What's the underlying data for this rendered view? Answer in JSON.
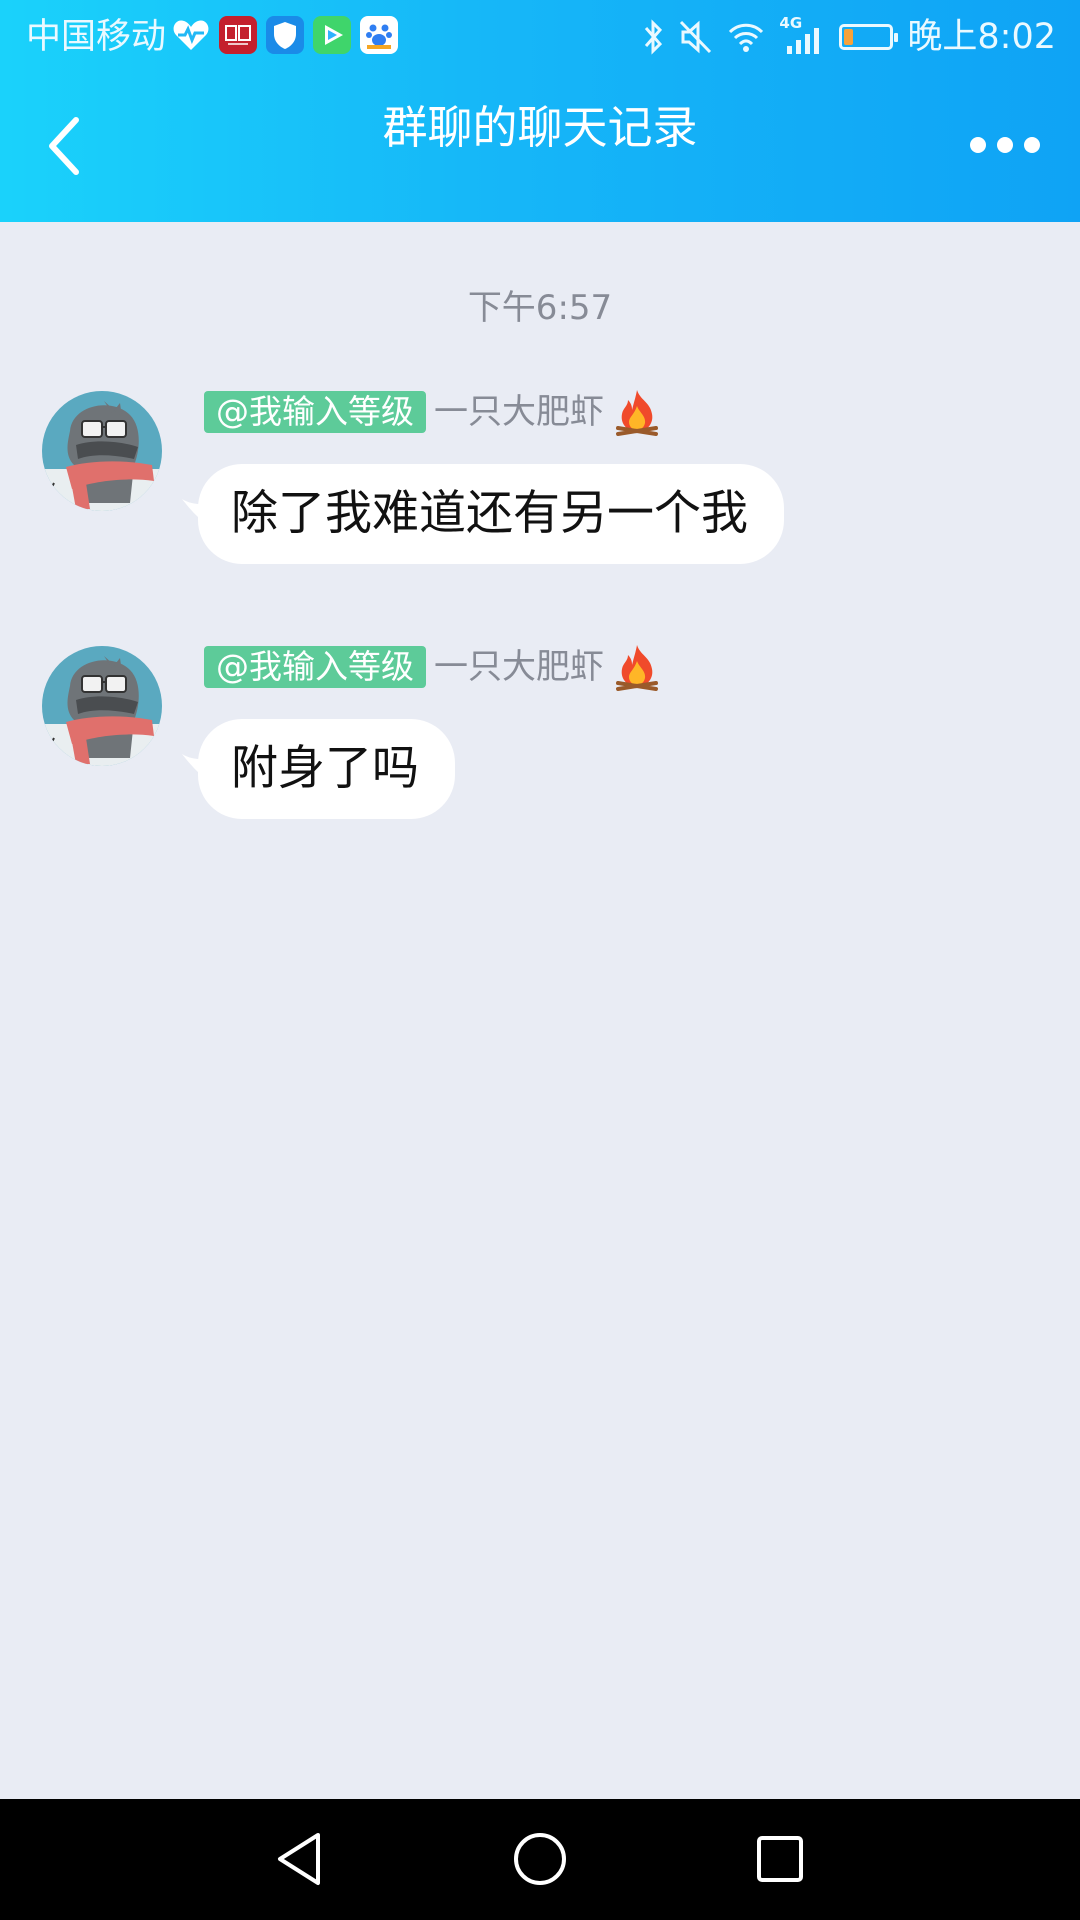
{
  "status_bar": {
    "carrier": "中国移动",
    "app_icons": [
      "health-heart-icon",
      "netease-news-icon",
      "security-shield-icon",
      "video-play-icon",
      "baidu-paw-icon"
    ],
    "indicators": [
      "bluetooth-icon",
      "mute-icon",
      "wifi-icon",
      "signal-4g-icon"
    ],
    "network_label": "4G",
    "battery_level": 0.2,
    "time": "晚上8:02",
    "colors": {
      "battery_fill": "#f7a23a"
    }
  },
  "header": {
    "title": "群聊的聊天记录",
    "back_icon": "chevron-left-icon",
    "more_icon": "more-dots-icon",
    "gradient": [
      "#1ad2fb",
      "#0fa3f5"
    ]
  },
  "chat": {
    "timestamp": "下午6:57",
    "messages": [
      {
        "tag": "@我输入等级",
        "sender": "一只大肥虾",
        "badge_icon": "fire-icon",
        "text": "除了我难道还有另一个我"
      },
      {
        "tag": "@我输入等级",
        "sender": "一只大肥虾",
        "badge_icon": "fire-icon",
        "text": "附身了吗"
      }
    ],
    "colors": {
      "background": "#e9ecf4",
      "tag": "#5dcb99",
      "bubble": "#ffffff"
    }
  },
  "system_nav": {
    "buttons": [
      "back-triangle-icon",
      "home-circle-icon",
      "recents-square-icon"
    ]
  }
}
